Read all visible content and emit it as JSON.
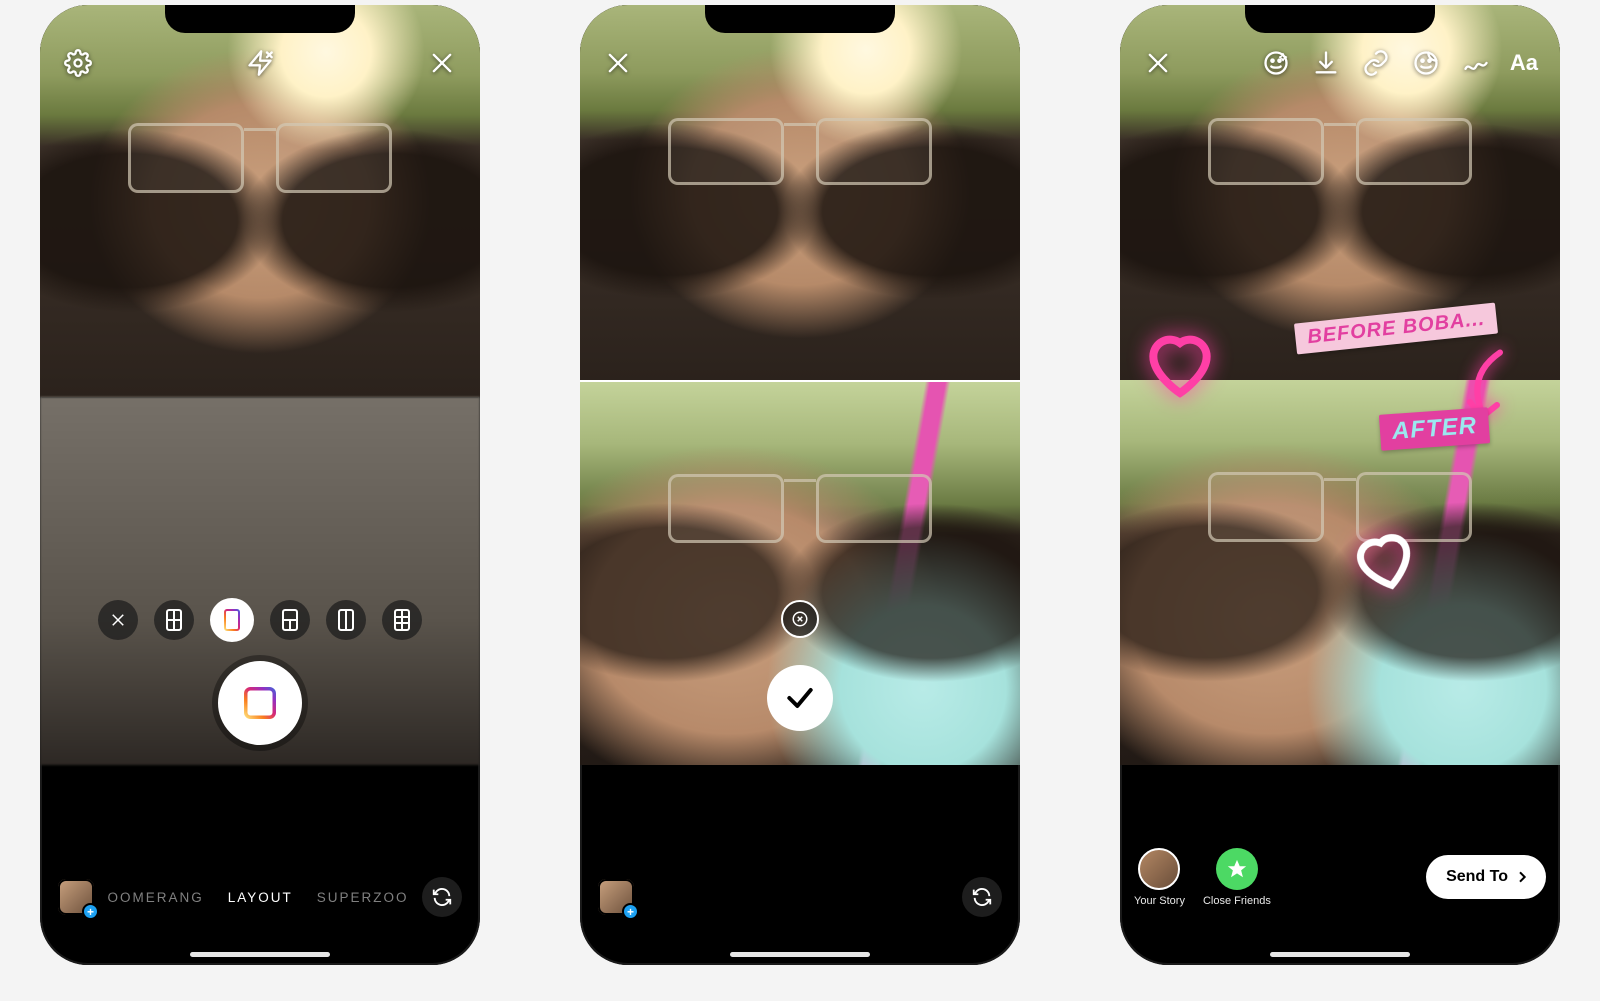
{
  "screen1": {
    "top": {
      "settings": "settings",
      "flash": "flash-off",
      "close": "close"
    },
    "layoutOptions": [
      "close",
      "grid-2x2",
      "split-h",
      "grid-3a",
      "split-v",
      "grid-2x3"
    ],
    "selectedLayoutIndex": 2,
    "modes": {
      "prev": "OOMERANG",
      "active": "LAYOUT",
      "next": "SUPERZOO"
    }
  },
  "screen2": {
    "top": {
      "close": "close"
    }
  },
  "screen3": {
    "top": {
      "close": "close",
      "effects": "effects",
      "save": "download",
      "link": "link",
      "sticker": "sticker",
      "draw": "draw",
      "text": "Aa"
    },
    "stickers": {
      "before": "BEFORE BOBA...",
      "after": "AFTER"
    },
    "share": {
      "story": "Your Story",
      "close_friends": "Close Friends",
      "send": "Send To"
    }
  }
}
